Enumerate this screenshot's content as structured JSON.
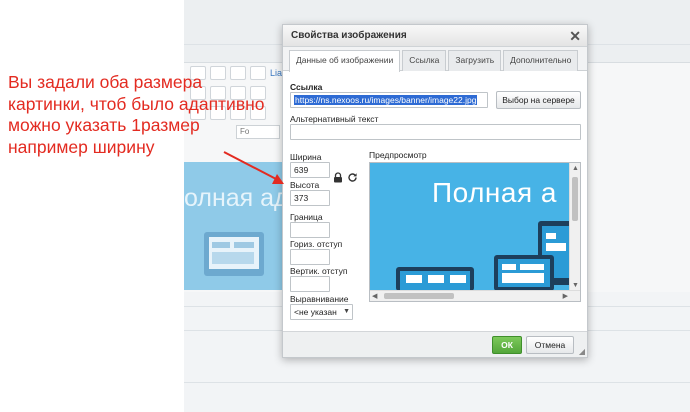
{
  "annotation": {
    "lines": [
      "Вы задали оба размера",
      "картинки, чтоб было адаптивно",
      "можно указать 1размер",
      "например ширину"
    ],
    "color": "#e32b21"
  },
  "background": {
    "banner_text": "олная ада",
    "link_text": "Lia",
    "select_value": "Fo"
  },
  "dialog": {
    "title": "Свойства изображения",
    "close_icon": "close-icon",
    "tabs": [
      {
        "label": "Данные об изображении",
        "active": true
      },
      {
        "label": "Ссылка",
        "active": false
      },
      {
        "label": "Загрузить",
        "active": false
      },
      {
        "label": "Дополнительно",
        "active": false
      }
    ],
    "url_label": "Ссылка",
    "url_value": "https://ns.nexoos.ru/images/banner/image22.jpg",
    "browse_button": "Выбор на сервере",
    "alt_label": "Альтернативный текст",
    "alt_value": "",
    "width_label": "Ширина",
    "width_value": "639",
    "height_label": "Высота",
    "height_value": "373",
    "lock_icon": "lock-icon",
    "reset_icon": "reset-size-icon",
    "border_label": "Граница",
    "border_value": "",
    "hspace_label": "Гориз. отступ",
    "hspace_value": "",
    "vspace_label": "Вертик. отступ",
    "vspace_value": "",
    "align_label": "Выравнивание",
    "align_value": "<не указан",
    "preview_label": "Предпросмотр",
    "preview_text": "Полная а",
    "ok_button": "ОК",
    "cancel_button": "Отмена",
    "accent_color": "#53a63a",
    "preview_color": "#47b3e6"
  }
}
